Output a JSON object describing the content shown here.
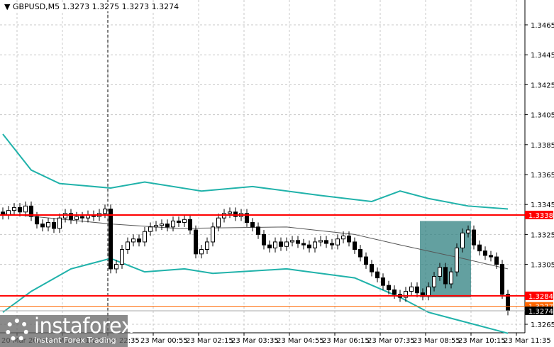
{
  "header": {
    "symbol": "GBPUSD,M5",
    "ohlc": "1.3273 1.3275 1.3273 1.3274"
  },
  "colors": {
    "band": "#20b2aa",
    "level": "#ff0000",
    "orange": "#ff6600",
    "zone": "#2f8080",
    "candle": "#000000"
  },
  "price_axis": {
    "labels": [
      "1.3465",
      "1.3445",
      "1.3425",
      "1.3405",
      "1.3385",
      "1.3365",
      "1.3345",
      "1.3325",
      "1.3305",
      "1.3265"
    ]
  },
  "tags": {
    "resistance": "1.3338",
    "support": "1.3284",
    "orange": "1.3277",
    "current": "1.3274"
  },
  "time_axis": {
    "labels": [
      "20 Mar 2025",
      "20 Mar 21:15",
      "20 Mar 22:35",
      "23 Mar 00:55",
      "23 Mar 02:15",
      "23 Mar 03:35",
      "23 Mar 04:55",
      "23 Mar 06:15",
      "23 Mar 07:35",
      "23 Mar 08:55",
      "23 Mar 10:15",
      "23 Mar 11:35"
    ]
  },
  "logo": {
    "name": "instaforex",
    "tagline": "Instant Forex Trading"
  },
  "chart_data": {
    "type": "candlestick",
    "ylim": [
      1.3255,
      1.348
    ],
    "closes": [
      1.3338,
      1.3341,
      1.3343,
      1.334,
      1.3344,
      1.3337,
      1.3332,
      1.333,
      1.3333,
      1.3329,
      1.3336,
      1.3339,
      1.3335,
      1.3337,
      1.3336,
      1.3338,
      1.3337,
      1.3339,
      1.3342,
      1.3302,
      1.3305,
      1.3315,
      1.332,
      1.3322,
      1.332,
      1.3327,
      1.333,
      1.3331,
      1.3332,
      1.333,
      1.3334,
      1.3333,
      1.3335,
      1.3328,
      1.3312,
      1.3315,
      1.332,
      1.333,
      1.3336,
      1.3339,
      1.334,
      1.3337,
      1.3339,
      1.3333,
      1.333,
      1.3325,
      1.3318,
      1.3316,
      1.332,
      1.3317,
      1.332,
      1.3321,
      1.3319,
      1.3318,
      1.3316,
      1.332,
      1.3321,
      1.3319,
      1.3318,
      1.3322,
      1.3324,
      1.332,
      1.3315,
      1.331,
      1.3305,
      1.33,
      1.3296,
      1.3291,
      1.3288,
      1.3285,
      1.3283,
      1.3287,
      1.329,
      1.3286,
      1.3284,
      1.329,
      1.3297,
      1.3303,
      1.3292,
      1.33,
      1.3316,
      1.3326,
      1.3328,
      1.3318,
      1.3314,
      1.3311,
      1.331,
      1.3305,
      1.3285,
      1.3274
    ],
    "bollinger": {
      "upper": [
        [
          0,
          1.3392
        ],
        [
          5,
          1.3368
        ],
        [
          10,
          1.3359
        ],
        [
          19,
          1.3356
        ],
        [
          25,
          1.336
        ],
        [
          35,
          1.3354
        ],
        [
          44,
          1.3357
        ],
        [
          56,
          1.3351
        ],
        [
          65,
          1.3347
        ],
        [
          70,
          1.3354
        ],
        [
          75,
          1.3349
        ],
        [
          82,
          1.3344
        ],
        [
          89,
          1.3342
        ]
      ],
      "middle": [
        [
          0,
          1.3339
        ],
        [
          19,
          1.3332
        ],
        [
          31,
          1.3329
        ],
        [
          50,
          1.333
        ],
        [
          62,
          1.3325
        ],
        [
          70,
          1.3318
        ],
        [
          81,
          1.3309
        ],
        [
          89,
          1.3302
        ]
      ],
      "lower": [
        [
          0,
          1.3273
        ],
        [
          5,
          1.3287
        ],
        [
          12,
          1.3302
        ],
        [
          19,
          1.3309
        ],
        [
          25,
          1.33
        ],
        [
          32,
          1.3302
        ],
        [
          37,
          1.3299
        ],
        [
          50,
          1.3302
        ],
        [
          62,
          1.3296
        ],
        [
          70,
          1.3283
        ],
        [
          75,
          1.3273
        ],
        [
          82,
          1.3266
        ],
        [
          89,
          1.3259
        ]
      ]
    },
    "levels": {
      "resistance": 1.3338,
      "support": 1.3284,
      "orange": 1.3277,
      "current": 1.3274
    },
    "zone": {
      "from_index": 74,
      "to_index": 82,
      "high": 1.3334,
      "low": 1.3283
    },
    "vline_index": 18.5
  }
}
